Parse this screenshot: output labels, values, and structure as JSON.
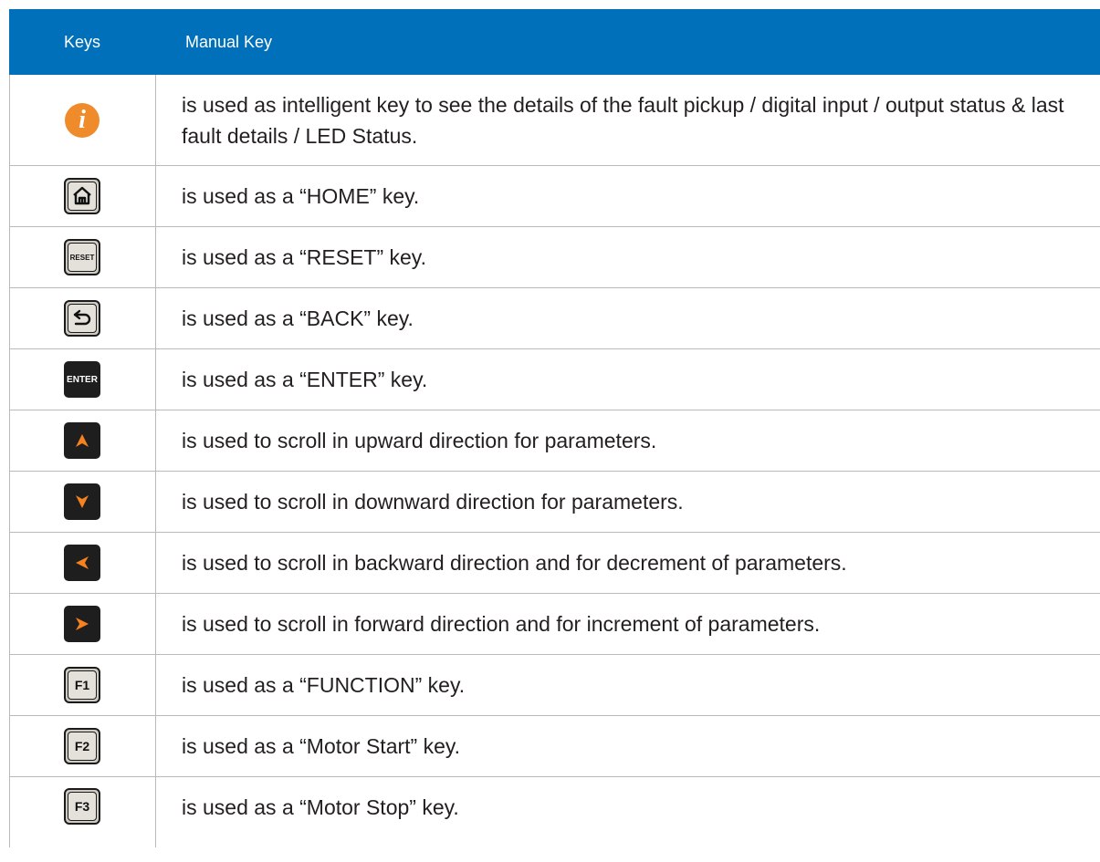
{
  "table": {
    "headers": {
      "keys": "Keys",
      "manual": "Manual Key"
    },
    "colors": {
      "header_bg": "#0070bb",
      "arrow": "#f5821f",
      "info": "#f08b2b"
    },
    "rows": [
      {
        "icon": "info-icon",
        "key_label": "i",
        "text": "is used as intelligent key to see the details of the fault pickup / digital input / output status & last fault details / LED Status."
      },
      {
        "icon": "home-icon",
        "key_label": "",
        "text": "is used as a “HOME” key."
      },
      {
        "icon": "reset-key-icon",
        "key_label": "RESET",
        "text": "is used as a “RESET” key."
      },
      {
        "icon": "back-arrow-icon",
        "key_label": "",
        "text": "is used as a “BACK” key."
      },
      {
        "icon": "enter-key-icon",
        "key_label": "ENTER",
        "text": "is used as a “ENTER” key."
      },
      {
        "icon": "arrow-up-icon",
        "key_label": "",
        "text": "is used to scroll in upward direction for parameters."
      },
      {
        "icon": "arrow-down-icon",
        "key_label": "",
        "text": "is used to scroll in downward direction for parameters."
      },
      {
        "icon": "arrow-left-icon",
        "key_label": "",
        "text": "is used to scroll in backward direction and for decrement of parameters."
      },
      {
        "icon": "arrow-right-icon",
        "key_label": "",
        "text": "is used to scroll in forward direction and for increment of parameters."
      },
      {
        "icon": "f1-key-icon",
        "key_label": "F1",
        "text": "is used as a “FUNCTION” key."
      },
      {
        "icon": "f2-key-icon",
        "key_label": "F2",
        "text": "is used as a “Motor Start” key."
      },
      {
        "icon": "f3-key-icon",
        "key_label": "F3",
        "text": "is used as a “Motor Stop” key."
      }
    ]
  }
}
